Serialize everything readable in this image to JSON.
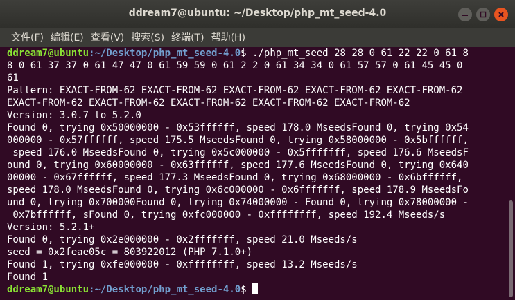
{
  "window": {
    "title": "ddream7@ubuntu: ~/Desktop/php_mt_seed-4.0"
  },
  "menu": [
    "文件(F)",
    "编辑(E)",
    "查看(V)",
    "搜索(S)",
    "终端(T)",
    "帮助(H)"
  ],
  "prompt": {
    "user_host": "ddream7@ubuntu",
    "path": ":~/Desktop/php_mt_seed-4.0",
    "symbol": "$"
  },
  "command": {
    "line1": " ./php_mt_seed 28 28 0 61 22 22 0 61 8",
    "line2": "8 0 61 37 37 0 61 47 47 0 61 59 59 0 61 2 2 0 61 34 34 0 61 57 57 0 61 45 45 0",
    "line3": "61"
  },
  "output": [
    "Pattern: EXACT-FROM-62 EXACT-FROM-62 EXACT-FROM-62 EXACT-FROM-62 EXACT-FROM-62",
    "EXACT-FROM-62 EXACT-FROM-62 EXACT-FROM-62 EXACT-FROM-62 EXACT-FROM-62",
    "Version: 3.0.7 to 5.2.0",
    "Found 0, trying 0x50000000 - 0x53ffffff, speed 178.0 MseedsFound 0, trying 0x54",
    "000000 - 0x57ffffff, speed 175.5 MseedsFound 0, trying 0x58000000 - 0x5bffffff,",
    " speed 176.0 MseedsFound 0, trying 0x5c000000 - 0x5fffffff, speed 176.6 MseedsF",
    "ound 0, trying 0x60000000 - 0x63ffffff, speed 177.6 MseedsFound 0, trying 0x640",
    "00000 - 0x67ffffff, speed 177.3 MseedsFound 0, trying 0x68000000 - 0x6bffffff,",
    "speed 178.0 MseedsFound 0, trying 0x6c000000 - 0x6fffffff, speed 178.9 MseedsFo",
    "und 0, trying 0x700000Found 0, trying 0x74000000 - Found 0, trying 0x78000000 -",
    " 0x7bffffff, sFound 0, trying 0xfc000000 - 0xffffffff, speed 192.4 Mseeds/s",
    "Version: 5.2.1+",
    "Found 0, trying 0x2e000000 - 0x2fffffff, speed 21.0 Mseeds/s",
    "seed = 0x2feae05c = 803922012 (PHP 7.1.0+)",
    "Found 1, trying 0xfe000000 - 0xffffffff, speed 13.2 Mseeds/s",
    "Found 1"
  ]
}
